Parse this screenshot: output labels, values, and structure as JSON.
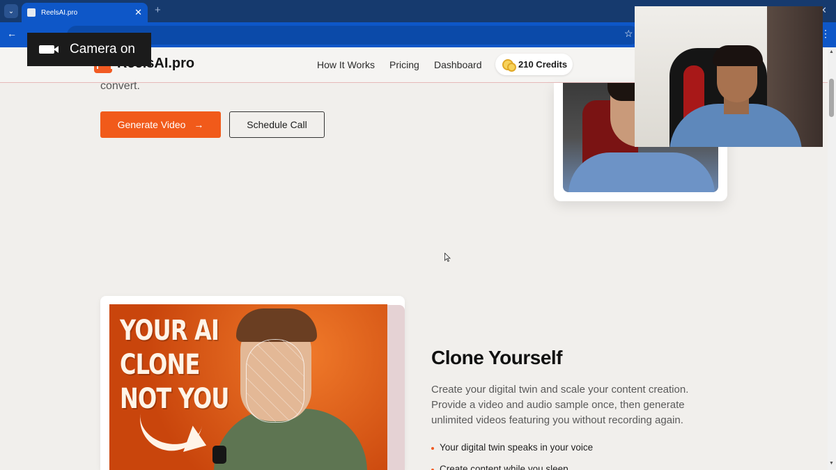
{
  "browser": {
    "tab_title": "ReelsAI.pro",
    "new_tab_label": "+",
    "close_tab_label": "✕",
    "window_close_label": "✕"
  },
  "camera_badge": {
    "label": "Camera on"
  },
  "header": {
    "logo_text": "ReelsAI.pro",
    "nav": [
      "How It Works",
      "Pricing",
      "Dashboard"
    ],
    "credits_label": "210 Credits"
  },
  "hero": {
    "text_fragment": "convert.",
    "primary_button": "Generate Video",
    "primary_button_arrow": "→",
    "secondary_button": "Schedule Call"
  },
  "clone": {
    "thumbnail_lines": [
      "YOUR AI",
      "CLONE",
      "NOT YOU"
    ],
    "title": "Clone Yourself",
    "description": "Create your digital twin and scale your content creation. Provide a video and audio sample once, then generate unlimited videos featuring you without recording again.",
    "bullets": [
      "Your digital twin speaks in your voice",
      "Create content while you sleep"
    ]
  },
  "colors": {
    "accent": "#f15a1a",
    "browser_bar": "#0e57c8",
    "page_bg": "#f1efec"
  }
}
